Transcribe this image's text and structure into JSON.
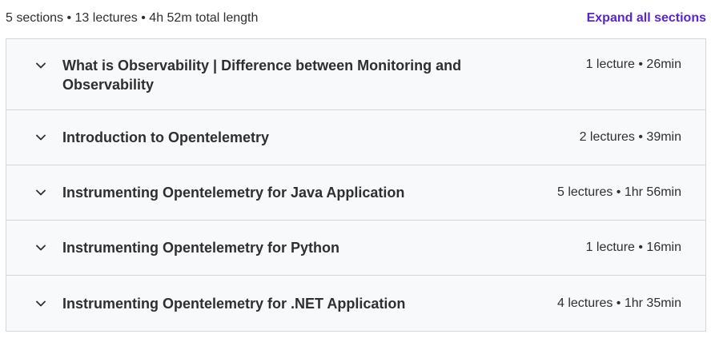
{
  "header": {
    "summary": "5 sections • 13 lectures • 4h 52m total length",
    "expand_all_label": "Expand all sections"
  },
  "sections": [
    {
      "title": "What is Observability | Difference between Monitoring and Observability",
      "meta": "1 lecture • 26min",
      "icon": "chevron-down-icon"
    },
    {
      "title": "Introduction to Opentelemetry",
      "meta": "2 lectures • 39min",
      "icon": "chevron-down-icon"
    },
    {
      "title": "Instrumenting Opentelemetry for Java Application",
      "meta": "5 lectures • 1hr 56min",
      "icon": "chevron-down-icon"
    },
    {
      "title": "Instrumenting Opentelemetry for Python",
      "meta": "1 lecture • 16min",
      "icon": "chevron-down-icon"
    },
    {
      "title": "Instrumenting Opentelemetry for .NET Application",
      "meta": "4 lectures • 1hr 35min",
      "icon": "chevron-down-icon"
    }
  ],
  "colors": {
    "accent": "#5624d0",
    "text": "#2d2f31",
    "section_bg": "#f7f9fa",
    "border": "#d1d7dc"
  }
}
